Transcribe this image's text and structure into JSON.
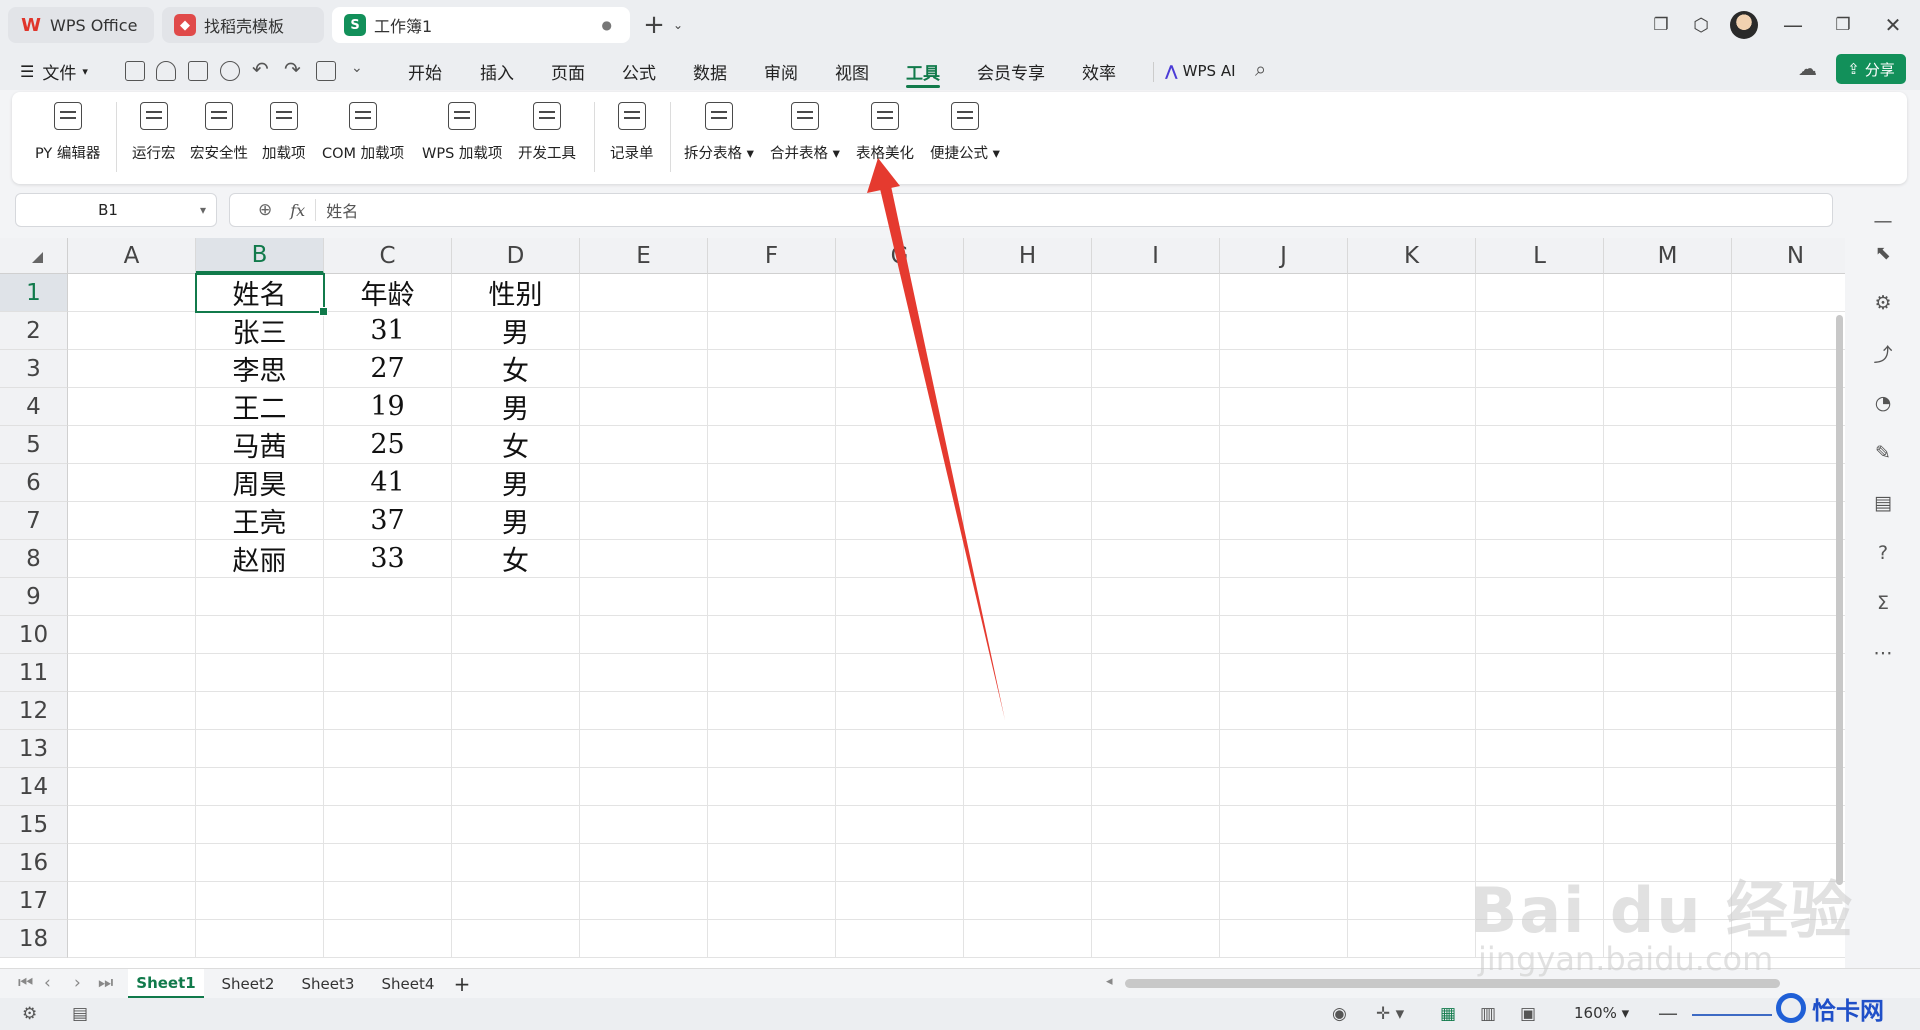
{
  "titlebar": {
    "tabs": [
      {
        "label": "WPS Office",
        "icon": "wps-logo-icon",
        "color": "#e0352b"
      },
      {
        "label": "找稻壳模板",
        "icon": "docer-icon",
        "color": "#e04a4a"
      },
      {
        "label": "工作簿1",
        "icon": "spreadsheet-icon",
        "icon_text": "S",
        "color": "#12905a"
      }
    ],
    "new_tab": "+"
  },
  "menubar": {
    "file_label": "文件",
    "items": [
      "开始",
      "插入",
      "页面",
      "公式",
      "数据",
      "审阅",
      "视图",
      "工具",
      "会员专享",
      "效率"
    ],
    "active": "工具",
    "ai_label": "WPS AI",
    "share_label": "分享"
  },
  "ribbon": {
    "items": [
      {
        "label": "PY 编辑器"
      },
      {
        "label": "运行宏"
      },
      {
        "label": "宏安全性"
      },
      {
        "label": "加载项"
      },
      {
        "label": "COM 加载项"
      },
      {
        "label": "WPS 加载项"
      },
      {
        "label": "开发工具"
      },
      {
        "label": "记录单"
      },
      {
        "label": "拆分表格"
      },
      {
        "label": "合并表格"
      },
      {
        "label": "表格美化"
      },
      {
        "label": "便捷公式"
      }
    ]
  },
  "formula_bar": {
    "cell_ref": "B1",
    "fx": "fx",
    "content": "姓名"
  },
  "grid": {
    "columns": [
      "A",
      "B",
      "C",
      "D",
      "E",
      "F",
      "G",
      "H",
      "I",
      "J",
      "K",
      "L",
      "M",
      "N"
    ],
    "selected_column": "B",
    "rows": [
      "1",
      "2",
      "3",
      "4",
      "5",
      "6",
      "7",
      "8",
      "9",
      "10",
      "11",
      "12",
      "13",
      "14",
      "15",
      "16",
      "17",
      "18"
    ],
    "selected_row": "1",
    "table": [
      [
        "姓名",
        "年龄",
        "性别"
      ],
      [
        "张三",
        "31",
        "男"
      ],
      [
        "李思",
        "27",
        "女"
      ],
      [
        "王二",
        "19",
        "男"
      ],
      [
        "马茜",
        "25",
        "女"
      ],
      [
        "周昊",
        "41",
        "男"
      ],
      [
        "王亮",
        "37",
        "男"
      ],
      [
        "赵丽",
        "33",
        "女"
      ]
    ]
  },
  "sheets": {
    "tabs": [
      "Sheet1",
      "Sheet2",
      "Sheet3",
      "Sheet4"
    ],
    "active": "Sheet1",
    "add": "+"
  },
  "statusbar": {
    "zoom": "160%"
  },
  "watermarks": {
    "baidu": "Bai du 经验",
    "url": "jingyan.baidu.com",
    "site": "恰卡网"
  },
  "colors": {
    "accent": "#117a4b",
    "share_button": "#12905a",
    "arrow": "#e53a2f"
  }
}
